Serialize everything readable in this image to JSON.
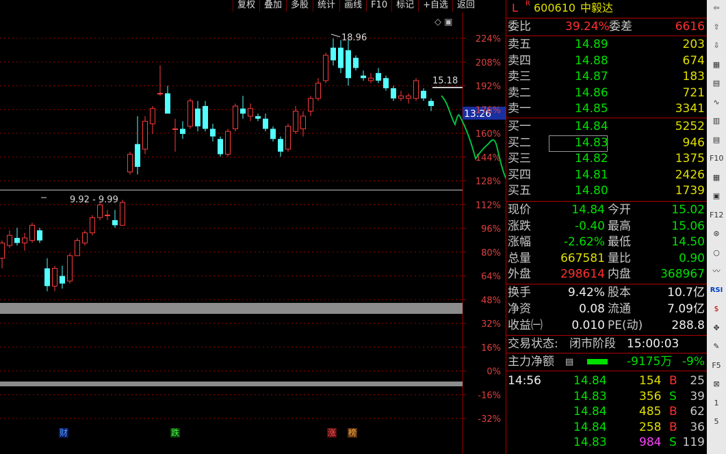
{
  "toolbar": [
    "复权",
    "叠加",
    "多股",
    "统计",
    "画线",
    "F10",
    "标记",
    "+自选",
    "返回"
  ],
  "chart": {
    "y_labels": [
      "224%",
      "208%",
      "192%",
      "176%",
      "160%",
      "144%",
      "128%",
      "112%",
      "96%",
      "80%",
      "64%",
      "48%",
      "32%",
      "16%",
      "0%",
      "-16%",
      "-32%"
    ],
    "high_label": "18.96",
    "current_label": "15.18",
    "cursor_price": "13.26",
    "low_label": "9.92 - 9.99",
    "markers": [
      "财",
      "跌",
      "涨",
      "榜"
    ],
    "colors": {
      "up": "#ff3c3c",
      "down": "#54ffff",
      "grid": "#a00000",
      "trend": "#00c040"
    }
  },
  "chart_data": {
    "type": "candlestick",
    "title": "",
    "candles": [
      {
        "o": 10.3,
        "h": 11.0,
        "l": 9.9,
        "c": 10.9
      },
      {
        "o": 10.8,
        "h": 11.4,
        "l": 10.7,
        "c": 11.2
      },
      {
        "o": 11.1,
        "h": 11.5,
        "l": 10.8,
        "c": 10.9
      },
      {
        "o": 10.9,
        "h": 11.3,
        "l": 10.6,
        "c": 11.1
      },
      {
        "o": 11.0,
        "h": 11.7,
        "l": 10.9,
        "c": 11.6
      },
      {
        "o": 11.4,
        "h": 11.5,
        "l": 10.9,
        "c": 11.0
      },
      {
        "o": 9.9,
        "h": 10.3,
        "l": 9.0,
        "c": 9.2
      },
      {
        "o": 9.2,
        "h": 10.0,
        "l": 9.0,
        "c": 9.9
      },
      {
        "o": 9.6,
        "h": 10.0,
        "l": 9.1,
        "c": 9.3
      },
      {
        "o": 9.4,
        "h": 10.5,
        "l": 9.3,
        "c": 10.4
      },
      {
        "o": 10.4,
        "h": 11.1,
        "l": 10.4,
        "c": 11.0
      },
      {
        "o": 10.9,
        "h": 11.4,
        "l": 10.8,
        "c": 11.3
      },
      {
        "o": 11.3,
        "h": 12.0,
        "l": 11.2,
        "c": 11.9
      },
      {
        "o": 11.9,
        "h": 12.5,
        "l": 11.8,
        "c": 12.4
      },
      {
        "o": 12.0,
        "h": 12.2,
        "l": 11.8,
        "c": 12.0
      },
      {
        "o": 11.8,
        "h": 12.2,
        "l": 11.5,
        "c": 11.6
      },
      {
        "o": 11.6,
        "h": 12.6,
        "l": 11.6,
        "c": 12.5
      },
      {
        "o": 13.7,
        "h": 14.5,
        "l": 13.6,
        "c": 14.4
      },
      {
        "o": 14.8,
        "h": 15.9,
        "l": 13.6,
        "c": 13.9
      },
      {
        "o": 14.6,
        "h": 15.9,
        "l": 14.4,
        "c": 15.7
      },
      {
        "o": 15.6,
        "h": 16.3,
        "l": 15.2,
        "c": 16.2
      },
      {
        "o": 16.8,
        "h": 17.9,
        "l": 16.7,
        "c": 16.8
      },
      {
        "o": 16.8,
        "h": 17.1,
        "l": 16.0,
        "c": 16.0
      },
      {
        "o": 15.4,
        "h": 15.8,
        "l": 14.5,
        "c": 15.4
      },
      {
        "o": 15.4,
        "h": 15.7,
        "l": 15.0,
        "c": 15.2
      },
      {
        "o": 15.5,
        "h": 16.6,
        "l": 15.4,
        "c": 16.5
      },
      {
        "o": 16.2,
        "h": 16.5,
        "l": 15.3,
        "c": 15.5
      },
      {
        "o": 16.3,
        "h": 16.5,
        "l": 15.3,
        "c": 15.4
      },
      {
        "o": 15.4,
        "h": 15.6,
        "l": 14.9,
        "c": 15.1
      },
      {
        "o": 15.0,
        "h": 15.1,
        "l": 14.3,
        "c": 14.4
      },
      {
        "o": 14.4,
        "h": 15.4,
        "l": 14.3,
        "c": 15.3
      },
      {
        "o": 15.4,
        "h": 16.4,
        "l": 15.3,
        "c": 16.3
      },
      {
        "o": 16.2,
        "h": 16.7,
        "l": 15.8,
        "c": 16.0
      },
      {
        "o": 15.9,
        "h": 16.4,
        "l": 15.7,
        "c": 16.2
      },
      {
        "o": 15.9,
        "h": 16.0,
        "l": 15.7,
        "c": 15.8
      },
      {
        "o": 15.8,
        "h": 16.0,
        "l": 15.3,
        "c": 15.4
      },
      {
        "o": 15.4,
        "h": 15.5,
        "l": 14.9,
        "c": 15.0
      },
      {
        "o": 15.0,
        "h": 15.1,
        "l": 14.3,
        "c": 14.5
      },
      {
        "o": 14.6,
        "h": 15.6,
        "l": 14.5,
        "c": 15.5
      },
      {
        "o": 15.3,
        "h": 16.3,
        "l": 15.2,
        "c": 16.1
      },
      {
        "o": 15.4,
        "h": 16.1,
        "l": 15.1,
        "c": 15.9
      },
      {
        "o": 16.1,
        "h": 16.7,
        "l": 15.9,
        "c": 16.6
      },
      {
        "o": 16.6,
        "h": 17.4,
        "l": 16.5,
        "c": 17.2
      },
      {
        "o": 17.3,
        "h": 18.4,
        "l": 17.2,
        "c": 18.3
      },
      {
        "o": 18.6,
        "h": 18.96,
        "l": 17.9,
        "c": 18.1
      },
      {
        "o": 18.6,
        "h": 18.9,
        "l": 17.6,
        "c": 17.8
      },
      {
        "o": 18.5,
        "h": 18.9,
        "l": 17.1,
        "c": 17.4
      },
      {
        "o": 18.2,
        "h": 18.3,
        "l": 17.7,
        "c": 17.8
      },
      {
        "o": 17.5,
        "h": 17.7,
        "l": 17.3,
        "c": 17.4
      },
      {
        "o": 17.3,
        "h": 17.6,
        "l": 17.2,
        "c": 17.4
      },
      {
        "o": 17.6,
        "h": 17.8,
        "l": 17.2,
        "c": 17.3
      },
      {
        "o": 17.4,
        "h": 17.5,
        "l": 16.9,
        "c": 17.0
      },
      {
        "o": 17.0,
        "h": 17.1,
        "l": 16.5,
        "c": 16.6
      },
      {
        "o": 16.6,
        "h": 16.9,
        "l": 16.5,
        "c": 16.7
      },
      {
        "o": 16.6,
        "h": 16.8,
        "l": 16.4,
        "c": 16.7
      },
      {
        "o": 16.6,
        "h": 17.4,
        "l": 16.5,
        "c": 17.3
      },
      {
        "o": 16.9,
        "h": 17.0,
        "l": 16.5,
        "c": 16.6
      },
      {
        "o": 16.5,
        "h": 16.6,
        "l": 16.1,
        "c": 16.3
      }
    ],
    "yrange_pct": [
      -32,
      224
    ]
  },
  "quote": {
    "code": "600610",
    "name": "中毅达",
    "wb_label": "委比",
    "wb_value": "39.24%",
    "wc_label": "委差",
    "wc_value": "6616",
    "sell": [
      {
        "label": "卖五",
        "price": "14.89",
        "vol": "203"
      },
      {
        "label": "卖四",
        "price": "14.88",
        "vol": "674"
      },
      {
        "label": "卖三",
        "price": "14.87",
        "vol": "183"
      },
      {
        "label": "卖二",
        "price": "14.86",
        "vol": "721"
      },
      {
        "label": "卖一",
        "price": "14.85",
        "vol": "3341"
      }
    ],
    "buy": [
      {
        "label": "买一",
        "price": "14.84",
        "vol": "5252"
      },
      {
        "label": "买二",
        "price": "14.83",
        "vol": "946"
      },
      {
        "label": "买三",
        "price": "14.82",
        "vol": "1375"
      },
      {
        "label": "买四",
        "price": "14.81",
        "vol": "2426"
      },
      {
        "label": "买五",
        "price": "14.80",
        "vol": "1739"
      }
    ],
    "stats": [
      {
        "l1": "现价",
        "v1": "14.84",
        "c1": "green",
        "l2": "今开",
        "v2": "15.02",
        "c2": "green"
      },
      {
        "l1": "涨跌",
        "v1": "-0.40",
        "c1": "green",
        "l2": "最高",
        "v2": "15.06",
        "c2": "green"
      },
      {
        "l1": "涨幅",
        "v1": "-2.62%",
        "c1": "green",
        "l2": "最低",
        "v2": "14.50",
        "c2": "green"
      },
      {
        "l1": "总量",
        "v1": "667581",
        "c1": "yellow",
        "l2": "量比",
        "v2": "0.90",
        "c2": "green"
      },
      {
        "l1": "外盘",
        "v1": "298614",
        "c1": "red",
        "l2": "内盘",
        "v2": "368967",
        "c2": "green"
      }
    ],
    "stats2": [
      {
        "l1": "换手",
        "v1": "9.42%",
        "l2": "股本",
        "v2": "10.7亿"
      },
      {
        "l1": "净资",
        "v1": "0.08",
        "l2": "流通",
        "v2": "7.09亿"
      },
      {
        "l1": "收益㈠",
        "v1": "0.010",
        "l2": "PE(动)",
        "v2": "288.8"
      }
    ],
    "status_label": "交易状态:",
    "status_value": "闭市阶段",
    "status_time": "15:00:03",
    "main_flow_label": "主力净额",
    "main_flow_value": "-9175万",
    "main_flow_pct": "-9%",
    "ticks": [
      {
        "time": "14:56",
        "price": "14.84",
        "vol": "154",
        "side": "B",
        "n": "25"
      },
      {
        "time": "",
        "price": "14.83",
        "vol": "356",
        "side": "S",
        "n": "39"
      },
      {
        "time": "",
        "price": "14.84",
        "vol": "485",
        "side": "B",
        "n": "62"
      },
      {
        "time": "",
        "price": "14.84",
        "vol": "258",
        "side": "B",
        "n": "36"
      },
      {
        "time": "",
        "price": "14.83",
        "vol": "984",
        "side": "S",
        "n": "119"
      }
    ]
  },
  "iconbar": [
    "⇦",
    "⇧",
    "⇩",
    "▦",
    "▤",
    "∿",
    "▥",
    "▤",
    "F10",
    "▦",
    "▣",
    "F12",
    "⊛",
    "○",
    "〰",
    "RSI",
    "$",
    "✥",
    "✎",
    "F5",
    "⊠",
    "1",
    "5"
  ]
}
